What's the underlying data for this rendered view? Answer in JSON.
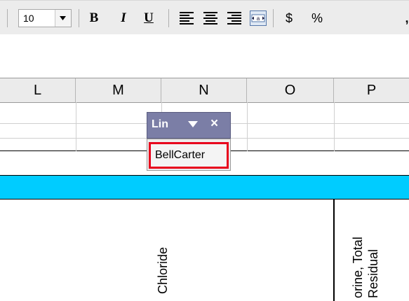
{
  "toolbar": {
    "font_size": "10",
    "bold_label": "B",
    "italic_label": "I",
    "underline_label": "U",
    "currency_label": "$",
    "percent_label": "%",
    "comma_label": ","
  },
  "columns": [
    "L",
    "M",
    "N",
    "O",
    "P"
  ],
  "headers": {
    "n_label": "Chloride",
    "p_line1": "orine, Total",
    "p_line2": "Residual"
  },
  "list_panel": {
    "title": "Lin",
    "selected_item": "BellCarter"
  },
  "colors": {
    "accent_row": "#00ccff",
    "panel_bg": "#7b7ea6",
    "highlight": "#e8001c"
  }
}
